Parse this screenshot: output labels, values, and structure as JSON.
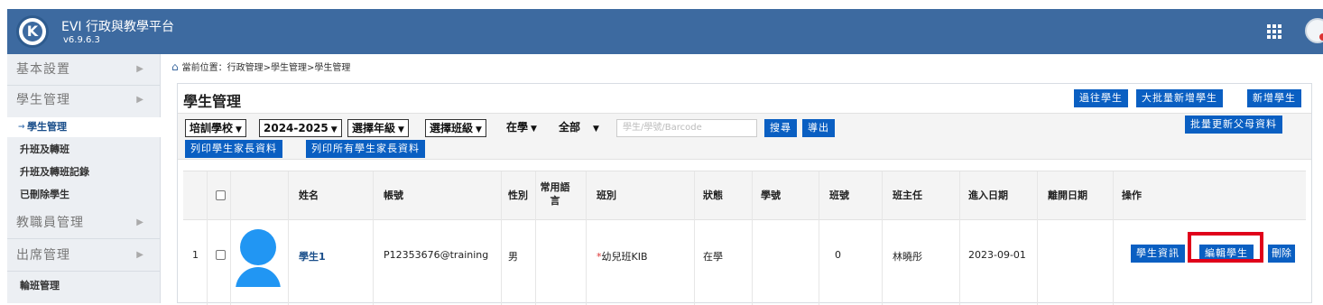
{
  "header": {
    "app_title": "EVI 行政與教學平台",
    "version": "v6.9.6.3",
    "colors": {
      "header_bg": "#3d6aa0",
      "primary_button": "#0a5fc2",
      "highlight": "#e0001a"
    }
  },
  "sidebar": {
    "items": [
      {
        "label": "基本設置",
        "type": "section"
      },
      {
        "label": "學生管理",
        "type": "section"
      },
      {
        "label": "學生管理",
        "type": "sub",
        "active": true
      },
      {
        "label": "升班及轉班",
        "type": "sub"
      },
      {
        "label": "升班及轉班記錄",
        "type": "sub"
      },
      {
        "label": "已刪除學生",
        "type": "sub"
      },
      {
        "label": "教職員管理",
        "type": "section"
      },
      {
        "label": "出席管理",
        "type": "section"
      },
      {
        "label": "輪班管理",
        "type": "sub"
      }
    ],
    "arrow": "▶"
  },
  "breadcrumb": {
    "text": "當前位置：行政管理>學生管理>學生管理"
  },
  "page": {
    "title": "學生管理",
    "buttons": {
      "past_students": "過往學生",
      "bulk_add": "大批量新增學生",
      "add_student": "新增學生",
      "bulk_update_parents": "批量更新父母資料"
    }
  },
  "filters": {
    "school": "培訓學校",
    "year": "2024-2025",
    "grade": "選擇年級",
    "class": "選擇班級",
    "status": "在學",
    "scope": "全部",
    "search_placeholder": "學生/學號/Barcode",
    "search_button": "搜尋",
    "export_button": "導出",
    "print_parents": "列印學生家長資料",
    "print_all_parents": "列印所有學生家長資料"
  },
  "table": {
    "headers": {
      "name": "姓名",
      "account": "帳號",
      "gender": "性別",
      "language": "常用語言",
      "class": "班別",
      "status": "狀態",
      "student_no": "學號",
      "class_no": "班號",
      "teacher": "班主任",
      "enter_date": "進入日期",
      "leave_date": "離開日期",
      "actions": "操作"
    },
    "rows": [
      {
        "index": "1",
        "name": "學生1",
        "account": "P12353676@training",
        "gender": "男",
        "language": "",
        "class_mark": "*",
        "class": "幼兒班KIB",
        "status": "在學",
        "student_no": "",
        "class_no": "0",
        "teacher": "林曉彤",
        "enter_date": "2023-09-01",
        "leave_date": "",
        "actions": {
          "info": "學生資訊",
          "edit": "編輯學生",
          "delete": "刪除"
        }
      }
    ]
  }
}
